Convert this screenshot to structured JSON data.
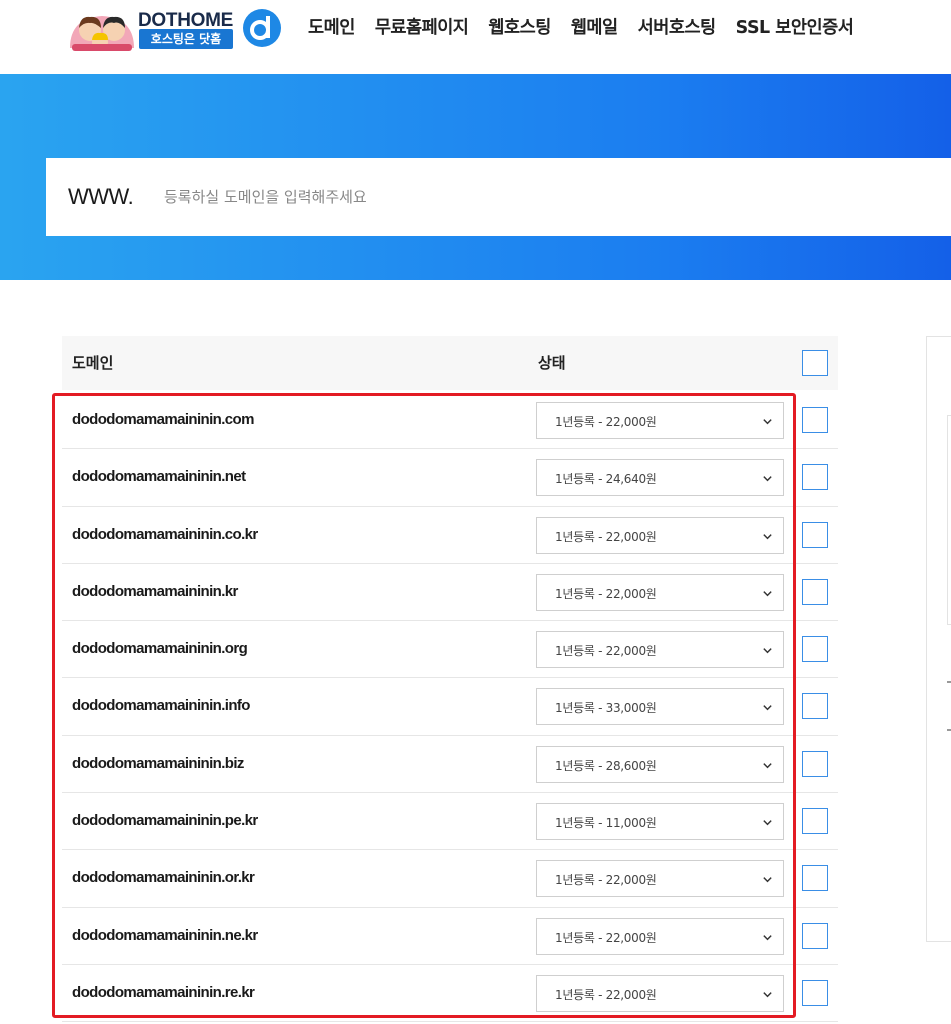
{
  "header": {
    "logo": {
      "brand_text": "DOTHOME",
      "tagline": "호스팅은 닷홈"
    },
    "nav": [
      {
        "label": "도메인"
      },
      {
        "label": "무료홈페이지"
      },
      {
        "label": "웹호스팅"
      },
      {
        "label": "웹메일"
      },
      {
        "label": "서버호스팅"
      },
      {
        "label": "SSL 보안인증서"
      }
    ]
  },
  "search": {
    "prefix": "WWW.",
    "placeholder": "등록하실 도메인을 입력해주세요",
    "value": ""
  },
  "table": {
    "headers": {
      "domain": "도메인",
      "status": "상태"
    },
    "rows": [
      {
        "domain": "dododomamamaininin.com",
        "option": "1년등록 - 22,000원"
      },
      {
        "domain": "dododomamamaininin.net",
        "option": "1년등록 - 24,640원"
      },
      {
        "domain": "dododomamamaininin.co.kr",
        "option": "1년등록 - 22,000원"
      },
      {
        "domain": "dododomamamaininin.kr",
        "option": "1년등록 - 22,000원"
      },
      {
        "domain": "dododomamamaininin.org",
        "option": "1년등록 - 22,000원"
      },
      {
        "domain": "dododomamamaininin.info",
        "option": "1년등록 - 33,000원"
      },
      {
        "domain": "dododomamamaininin.biz",
        "option": "1년등록 - 28,600원"
      },
      {
        "domain": "dododomamamaininin.pe.kr",
        "option": "1년등록 - 11,000원"
      },
      {
        "domain": "dododomamamaininin.or.kr",
        "option": "1년등록 - 22,000원"
      },
      {
        "domain": "dododomamamaininin.ne.kr",
        "option": "1년등록 - 22,000원"
      },
      {
        "domain": "dododomamamaininin.re.kr",
        "option": "1년등록 - 22,000원"
      }
    ]
  },
  "colors": {
    "hero_start": "#2aa4f0",
    "hero_end": "#1460e8",
    "checkbox_border": "#3a8ee6",
    "highlight": "#e31b23"
  },
  "icons": {
    "logo_mark": "dothome-d-icon",
    "select_arrow": "chevron-down-icon"
  }
}
